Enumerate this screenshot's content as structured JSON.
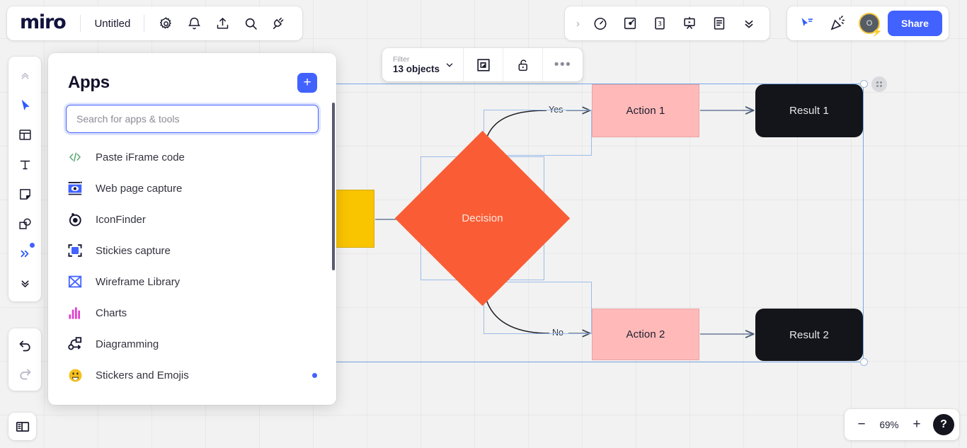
{
  "app": {
    "logo": "miro",
    "document_title": "Untitled"
  },
  "topbar": {
    "left_icons": [
      {
        "name": "settings-gear-icon",
        "label": "Settings"
      },
      {
        "name": "notifications-bell-icon",
        "label": "Notifications"
      },
      {
        "name": "upload-icon",
        "label": "Upload"
      },
      {
        "name": "search-icon",
        "label": "Search"
      },
      {
        "name": "apps-plug-icon",
        "label": "Apps"
      }
    ],
    "right_icons": [
      {
        "name": "expand-chevron-right-icon",
        "label": "Expand"
      },
      {
        "name": "timer-icon",
        "label": "Timer"
      },
      {
        "name": "voting-icon",
        "label": "Voting"
      },
      {
        "name": "estimation-icon",
        "label": "Estimation"
      },
      {
        "name": "presentation-icon",
        "label": "Presentation mode"
      },
      {
        "name": "notes-icon",
        "label": "Notes"
      },
      {
        "name": "more-chevrons-down-icon",
        "label": "More"
      }
    ],
    "far_icons": [
      {
        "name": "cursor-share-icon",
        "label": "Bring to me"
      },
      {
        "name": "celebration-icon",
        "label": "Reactions"
      }
    ],
    "avatar_initial": "O",
    "share_label": "Share"
  },
  "context_toolbar": {
    "filter_label": "Filter",
    "filter_value": "13 objects",
    "chevron": "chevron-down-icon",
    "actions": [
      {
        "name": "frame-icon",
        "label": "Frame selection"
      },
      {
        "name": "unlock-icon",
        "label": "Lock"
      },
      {
        "name": "more-dots-icon",
        "label": "More options"
      }
    ]
  },
  "left_toolbar": {
    "items": [
      {
        "name": "collapse-up-icon",
        "label": "Collapse"
      },
      {
        "name": "cursor-select-icon",
        "label": "Select"
      },
      {
        "name": "templates-icon",
        "label": "Templates"
      },
      {
        "name": "text-icon",
        "label": "Text"
      },
      {
        "name": "sticky-note-icon",
        "label": "Sticky note"
      },
      {
        "name": "shapes-icon",
        "label": "Shapes"
      },
      {
        "name": "more-tools-icon",
        "label": "More tools",
        "badge": true
      },
      {
        "name": "expand-down-icon",
        "label": "Expand"
      }
    ],
    "history": [
      {
        "name": "undo-icon",
        "label": "Undo"
      },
      {
        "name": "redo-icon",
        "label": "Redo"
      }
    ],
    "panel_toggle": {
      "name": "toggle-panel-icon",
      "label": "Toggle side panel"
    }
  },
  "apps_panel": {
    "title": "Apps",
    "add_button_label": "+",
    "search": {
      "placeholder": "Search for apps & tools",
      "value": ""
    },
    "items": [
      {
        "label": "Paste iFrame code",
        "icon": "code-brackets-icon",
        "new": false
      },
      {
        "label": "Web page capture",
        "icon": "web-capture-icon",
        "new": false
      },
      {
        "label": "IconFinder",
        "icon": "iconfinder-icon",
        "new": false
      },
      {
        "label": "Stickies capture",
        "icon": "stickies-capture-icon",
        "new": false
      },
      {
        "label": "Wireframe Library",
        "icon": "wireframe-icon",
        "new": false
      },
      {
        "label": "Charts",
        "icon": "charts-icon",
        "new": false
      },
      {
        "label": "Diagramming",
        "icon": "diagramming-icon",
        "new": false
      },
      {
        "label": "Stickers and Emojis",
        "icon": "emoji-icon",
        "new": true
      }
    ]
  },
  "zoom_controls": {
    "minus_label": "−",
    "value": "69%",
    "plus_label": "+",
    "help_label": "?"
  },
  "canvas": {
    "nodes": [
      {
        "id": "start",
        "label": "",
        "shape": "rect",
        "color": "#f9c400"
      },
      {
        "id": "decision",
        "label": "Decision",
        "shape": "diamond",
        "color": "#fa5d35"
      },
      {
        "id": "action1",
        "label": "Action 1",
        "shape": "rect",
        "color": "#ffb9b9"
      },
      {
        "id": "action2",
        "label": "Action 2",
        "shape": "rect",
        "color": "#ffb9b9"
      },
      {
        "id": "result1",
        "label": "Result 1",
        "shape": "rounded",
        "color": "#13151a"
      },
      {
        "id": "result2",
        "label": "Result 2",
        "shape": "rounded",
        "color": "#13151a"
      }
    ],
    "edge_labels": [
      {
        "id": "yes",
        "label": "Yes"
      },
      {
        "id": "no",
        "label": "No"
      }
    ]
  },
  "colors": {
    "brand_blue": "#4262ff",
    "selection_blue": "#7aa7e8",
    "decision_orange": "#fa5d35",
    "action_pink": "#ffb9b9",
    "start_yellow": "#f9c400",
    "result_black": "#13151a"
  }
}
